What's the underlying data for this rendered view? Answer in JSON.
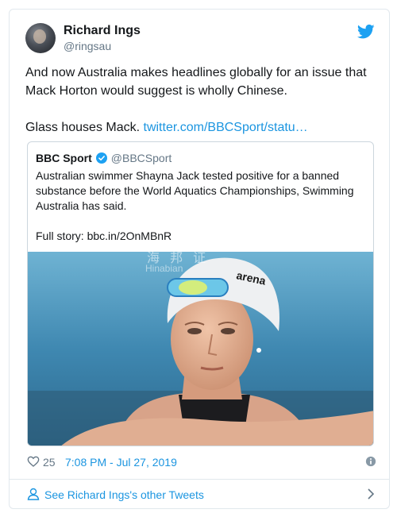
{
  "author": {
    "name": "Richard Ings",
    "handle": "@ringsau"
  },
  "tweet": {
    "line1": "And now Australia makes headlines globally for an issue that Mack Horton would suggest is wholly Chinese.",
    "line2_prefix": "Glass houses Mack. ",
    "line2_link": "twitter.com/BBCSport/statu…"
  },
  "quoted": {
    "name": "BBC Sport",
    "handle": "@BBCSport",
    "text": "Australian swimmer Shayna Jack tested positive for a banned substance before the World Aquatics Championships, Swimming Australia has said.",
    "full_story": "Full story: bbc.in/2OnMBnR",
    "image_watermark": "海 邦 证",
    "image_watermark_sub": "Hinabian"
  },
  "meta": {
    "likes": "25",
    "timestamp": "7:08 PM - Jul 27, 2019"
  },
  "see_more": {
    "label": "See Richard Ings's other Tweets"
  },
  "colors": {
    "link": "#1b95e0",
    "text": "#14171a",
    "muted": "#657786",
    "border": "#e1e8ed"
  },
  "icons": [
    "twitter-bird-icon",
    "verified-badge-icon",
    "heart-icon",
    "info-icon",
    "person-icon",
    "chevron-right-icon"
  ]
}
